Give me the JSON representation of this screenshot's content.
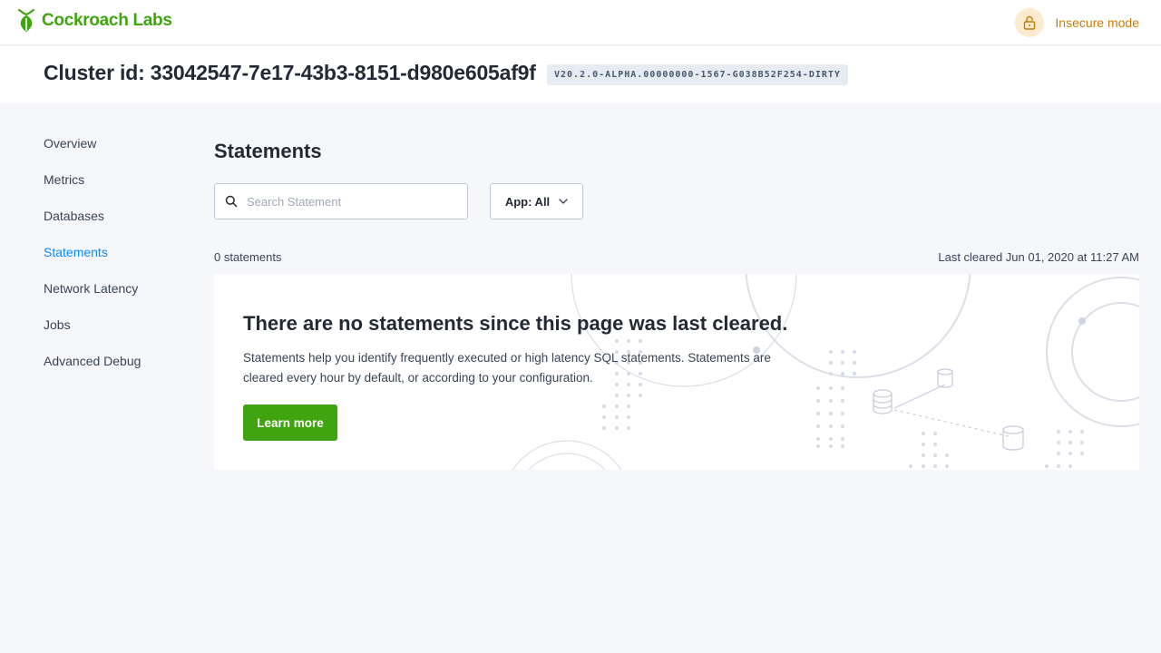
{
  "header": {
    "logo_text": "Cockroach Labs",
    "insecure_label": "Insecure mode"
  },
  "cluster": {
    "title": "Cluster id: 33042547-7e17-43b3-8151-d980e605af9f",
    "version": "V20.2.0-ALPHA.00000000-1567-G038B52F254-DIRTY"
  },
  "sidebar": {
    "items": [
      {
        "label": "Overview",
        "active": false
      },
      {
        "label": "Metrics",
        "active": false
      },
      {
        "label": "Databases",
        "active": false
      },
      {
        "label": "Statements",
        "active": true
      },
      {
        "label": "Network Latency",
        "active": false
      },
      {
        "label": "Jobs",
        "active": false
      },
      {
        "label": "Advanced Debug",
        "active": false
      }
    ]
  },
  "main": {
    "title": "Statements",
    "search_placeholder": "Search Statement",
    "app_select_label": "App: All",
    "count_text": "0 statements",
    "last_cleared": "Last cleared Jun 01, 2020 at 11:27 AM",
    "empty": {
      "title": "There are no statements since this page was last cleared.",
      "description": "Statements help you identify frequently executed or high latency SQL statements. Statements are cleared every hour by default, or according to your configuration.",
      "button_label": "Learn more"
    }
  },
  "colors": {
    "brand_green": "#3fa40f",
    "active_blue": "#0788ff",
    "warning_orange": "#c47c0a",
    "background": "#f5f7fa"
  }
}
